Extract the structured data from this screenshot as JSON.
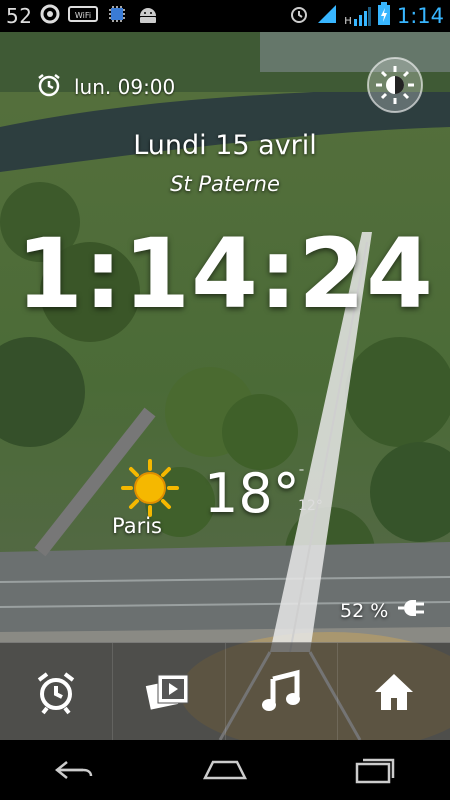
{
  "status_bar": {
    "left_number": "52",
    "left_icons": [
      "cyanogen-icon",
      "wifi-icon",
      "cpu-icon",
      "android-icon"
    ],
    "right_icons": [
      "alarm-clock-icon",
      "wifi-signal-icon",
      "h-signal-icon",
      "battery-charging-icon"
    ],
    "network_label": "H",
    "time": "1:14",
    "time_color": "#38b6ff"
  },
  "alarm": {
    "text": "lun. 09:00"
  },
  "date": {
    "day": "Lundi 15 avril",
    "saint": "St Paterne"
  },
  "clock": {
    "time": "1:14:24"
  },
  "weather": {
    "city": "Paris",
    "temperature": "18°",
    "max": "¯",
    "min": "12°",
    "icon": "sun-icon",
    "sun_color": "#f5b800"
  },
  "battery": {
    "percent": "52 %",
    "icon": "charging-plug-icon"
  },
  "dock": {
    "items": [
      {
        "name": "alarm-button",
        "icon": "alarm-clock-icon"
      },
      {
        "name": "gallery-button",
        "icon": "photo-slideshow-icon"
      },
      {
        "name": "music-button",
        "icon": "music-note-icon"
      },
      {
        "name": "home-button",
        "icon": "home-icon"
      }
    ]
  },
  "navbar": {
    "items": [
      "back-icon",
      "home-outline-icon",
      "recent-apps-icon"
    ]
  }
}
